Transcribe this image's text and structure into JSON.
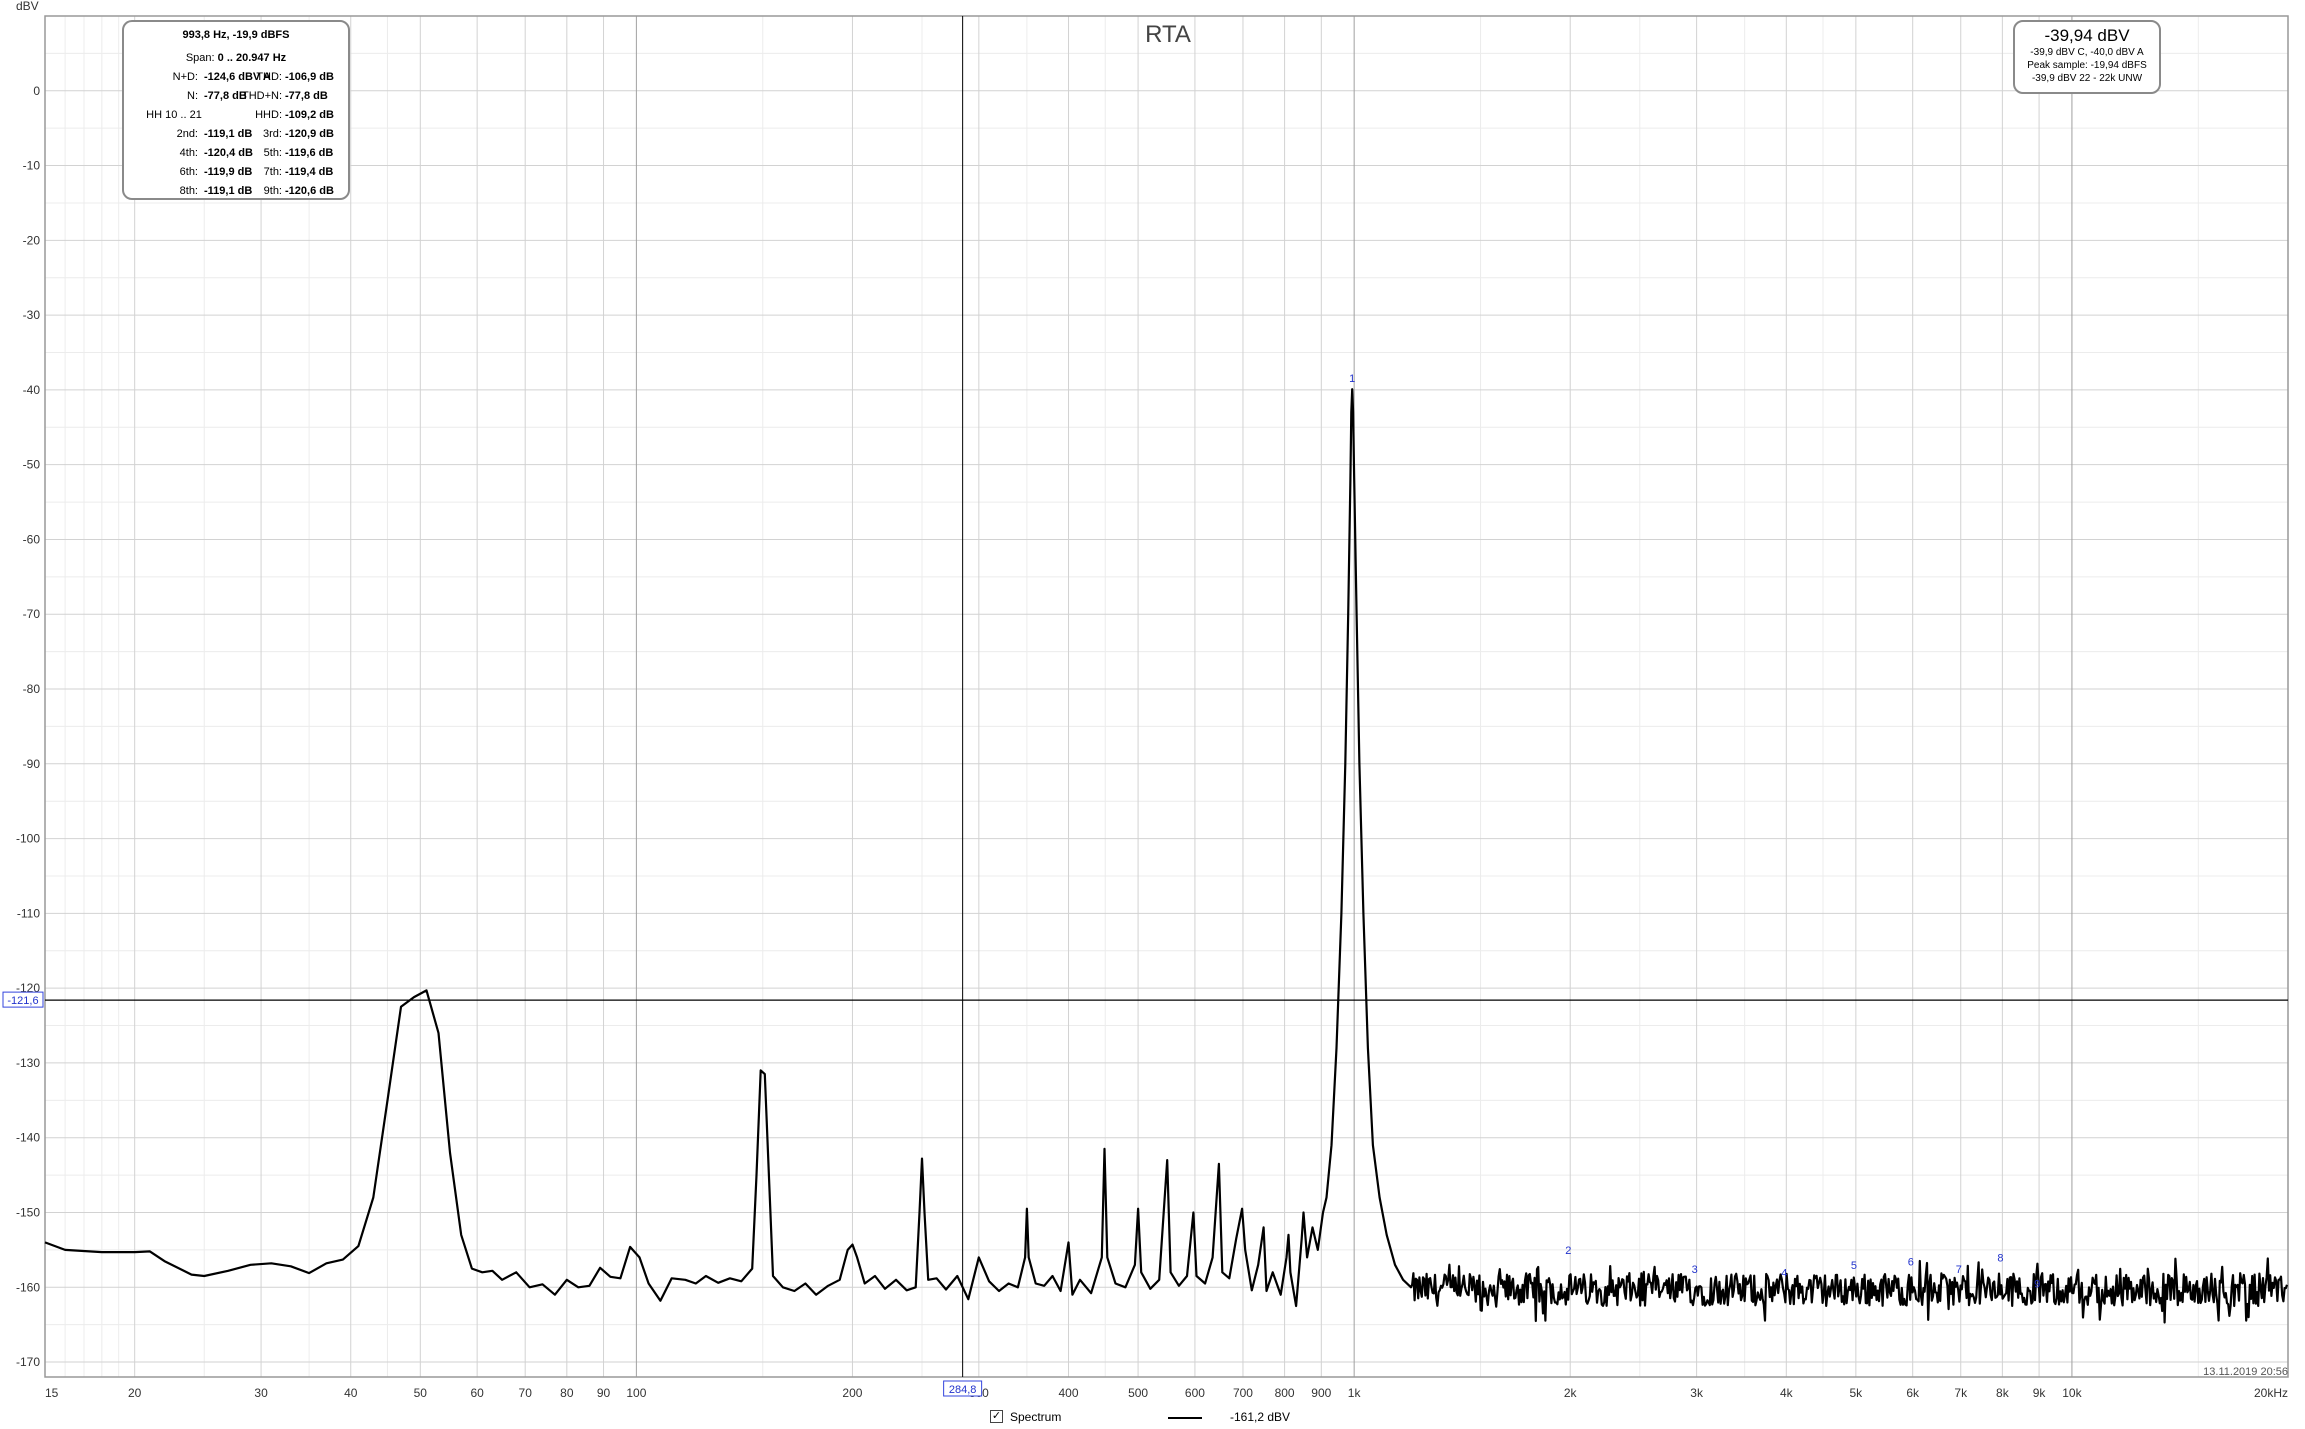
{
  "stats": {
    "freq_line": "993,8 Hz, -19,9 dBFS",
    "span_label": "Span:",
    "span_value": "0 .. 20.947 Hz",
    "rows": [
      {
        "l": "N+D:",
        "lv": "-124,6 dBV A",
        "r": "THD:",
        "rv": "-106,9 dB"
      },
      {
        "l": "N:",
        "lv": "-77,8 dB",
        "r": "THD+N:",
        "rv": "-77,8 dB"
      },
      {
        "c": "HH 10 .. 21",
        "r": "HHD:",
        "rv": "-109,2 dB"
      },
      {
        "l": "2nd:",
        "lv": "-119,1 dB",
        "r": "3rd:",
        "rv": "-120,9 dB"
      },
      {
        "l": "4th:",
        "lv": "-120,4 dB",
        "r": "5th:",
        "rv": "-119,6 dB"
      },
      {
        "l": "6th:",
        "lv": "-119,9 dB",
        "r": "7th:",
        "rv": "-119,4 dB"
      },
      {
        "l": "8th:",
        "lv": "-119,1 dB",
        "r": "9th:",
        "rv": "-120,6 dB"
      }
    ]
  },
  "level": {
    "main": "-39,94 dBV",
    "line1": "-39,9 dBV C, -40,0 dBV A",
    "line2": "Peak sample: -19,94 dBFS",
    "line3": "-39,9 dBV 22 - 22k UNW"
  },
  "legend": {
    "checked": true,
    "checkbox_mark": "✓",
    "label": "Spectrum",
    "value": "-161,2 dBV"
  },
  "timestamp": "13.11.2019 20:56",
  "colors": {
    "trace": "#000000",
    "grid": "#d2d2d2",
    "cursor": "#000000",
    "marker_text": "#2233cc"
  },
  "chart_data": {
    "type": "line",
    "title": "RTA",
    "ylabel": "dBV",
    "xscale": "log",
    "xlim": [
      15,
      20000
    ],
    "ylim": [
      -172,
      10
    ],
    "grid": true,
    "xticks": [
      {
        "v": 15,
        "t": "15"
      },
      {
        "v": 20,
        "t": "20"
      },
      {
        "v": 30,
        "t": "30"
      },
      {
        "v": 40,
        "t": "40"
      },
      {
        "v": 50,
        "t": "50"
      },
      {
        "v": 60,
        "t": "60"
      },
      {
        "v": 70,
        "t": "70"
      },
      {
        "v": 80,
        "t": "80"
      },
      {
        "v": 90,
        "t": "90"
      },
      {
        "v": 100,
        "t": "100"
      },
      {
        "v": 200,
        "t": "200"
      },
      {
        "v": 300,
        "t": "300"
      },
      {
        "v": 400,
        "t": "400"
      },
      {
        "v": 500,
        "t": "500"
      },
      {
        "v": 600,
        "t": "600"
      },
      {
        "v": 700,
        "t": "700"
      },
      {
        "v": 800,
        "t": "800"
      },
      {
        "v": 900,
        "t": "900"
      },
      {
        "v": 1000,
        "t": "1k"
      },
      {
        "v": 2000,
        "t": "2k"
      },
      {
        "v": 3000,
        "t": "3k"
      },
      {
        "v": 4000,
        "t": "4k"
      },
      {
        "v": 5000,
        "t": "5k"
      },
      {
        "v": 6000,
        "t": "6k"
      },
      {
        "v": 7000,
        "t": "7k"
      },
      {
        "v": 8000,
        "t": "8k"
      },
      {
        "v": 9000,
        "t": "9k"
      },
      {
        "v": 10000,
        "t": "10k"
      },
      {
        "v": 20000,
        "t": "20kHz"
      }
    ],
    "yticks": [
      0,
      -10,
      -20,
      -30,
      -40,
      -50,
      -60,
      -70,
      -80,
      -90,
      -100,
      -110,
      -120,
      -130,
      -140,
      -150,
      -160,
      -170
    ],
    "cursor": {
      "x": 284.8,
      "x_label": "284,8",
      "y": -121.6,
      "y_label": "-121,6"
    },
    "harmonic_markers": [
      {
        "n": "1",
        "f": 993.8,
        "db": -39.9
      },
      {
        "n": "2",
        "f": 1987.6,
        "db": -156.5
      },
      {
        "n": "3",
        "f": 2981.4,
        "db": -159.0
      },
      {
        "n": "4",
        "f": 3975.2,
        "db": -159.5
      },
      {
        "n": "5",
        "f": 4969.0,
        "db": -158.5
      },
      {
        "n": "6",
        "f": 5962.8,
        "db": -158.0
      },
      {
        "n": "7",
        "f": 6956.6,
        "db": -159.0
      },
      {
        "n": "8",
        "f": 7950.4,
        "db": -157.5
      },
      {
        "n": "9",
        "f": 8944.2,
        "db": -161.0
      }
    ],
    "series": [
      {
        "points": [
          [
            15,
            -154
          ],
          [
            16,
            -155
          ],
          [
            18,
            -155.3
          ],
          [
            20,
            -155.3
          ],
          [
            21,
            -155.2
          ],
          [
            22,
            -156.5
          ],
          [
            24,
            -158.3
          ],
          [
            25,
            -158.5
          ],
          [
            27,
            -157.8
          ],
          [
            29,
            -157.0
          ],
          [
            31,
            -156.8
          ],
          [
            33,
            -157.2
          ],
          [
            35,
            -158.1
          ],
          [
            37,
            -156.8
          ],
          [
            39,
            -156.3
          ],
          [
            41,
            -154.5
          ],
          [
            43,
            -148
          ],
          [
            45,
            -135
          ],
          [
            47,
            -122.5
          ],
          [
            49,
            -121.2
          ],
          [
            51,
            -120.3
          ],
          [
            53,
            -126
          ],
          [
            55,
            -142
          ],
          [
            57,
            -153
          ],
          [
            59,
            -157.5
          ],
          [
            61,
            -158
          ],
          [
            63,
            -157.8
          ],
          [
            65,
            -159
          ],
          [
            68,
            -158
          ],
          [
            71,
            -160
          ],
          [
            74,
            -159.6
          ],
          [
            77,
            -161
          ],
          [
            80,
            -159
          ],
          [
            83,
            -160
          ],
          [
            86,
            -159.8
          ],
          [
            89,
            -157.4
          ],
          [
            92,
            -158.6
          ],
          [
            95,
            -158.8
          ],
          [
            98,
            -154.6
          ],
          [
            101,
            -156
          ],
          [
            104,
            -159.5
          ],
          [
            108,
            -161.8
          ],
          [
            112,
            -158.8
          ],
          [
            117,
            -159
          ],
          [
            121,
            -159.5
          ],
          [
            125,
            -158.5
          ],
          [
            130,
            -159.4
          ],
          [
            135,
            -158.8
          ],
          [
            140,
            -159.2
          ],
          [
            145,
            -157.5
          ],
          [
            147,
            -145
          ],
          [
            149,
            -131
          ],
          [
            151,
            -131.5
          ],
          [
            153,
            -145
          ],
          [
            155,
            -158.5
          ],
          [
            160,
            -160
          ],
          [
            166,
            -160.5
          ],
          [
            172,
            -159.5
          ],
          [
            178,
            -161
          ],
          [
            185,
            -159.8
          ],
          [
            192,
            -159
          ],
          [
            197,
            -155
          ],
          [
            200,
            -154.3
          ],
          [
            203,
            -156
          ],
          [
            208,
            -159.5
          ],
          [
            215,
            -158.5
          ],
          [
            222,
            -160.2
          ],
          [
            230,
            -159
          ],
          [
            238,
            -160.4
          ],
          [
            245,
            -160
          ],
          [
            248,
            -150
          ],
          [
            250,
            -142.8
          ],
          [
            252,
            -150
          ],
          [
            255,
            -159
          ],
          [
            262,
            -158.8
          ],
          [
            270,
            -160.3
          ],
          [
            280,
            -158.5
          ],
          [
            290,
            -161.6
          ],
          [
            300,
            -156
          ],
          [
            310,
            -159.2
          ],
          [
            320,
            -160.5
          ],
          [
            330,
            -159.5
          ],
          [
            340,
            -160
          ],
          [
            348,
            -156
          ],
          [
            350,
            -149.5
          ],
          [
            352,
            -156
          ],
          [
            360,
            -159.5
          ],
          [
            370,
            -159.8
          ],
          [
            380,
            -158.5
          ],
          [
            390,
            -160.5
          ],
          [
            400,
            -154
          ],
          [
            405,
            -161
          ],
          [
            415,
            -159
          ],
          [
            430,
            -160.8
          ],
          [
            445,
            -156
          ],
          [
            449,
            -141.5
          ],
          [
            453,
            -156
          ],
          [
            465,
            -159.5
          ],
          [
            480,
            -160
          ],
          [
            495,
            -157
          ],
          [
            500,
            -149.5
          ],
          [
            505,
            -158
          ],
          [
            520,
            -160.2
          ],
          [
            535,
            -159
          ],
          [
            549,
            -143
          ],
          [
            555,
            -158
          ],
          [
            570,
            -159.8
          ],
          [
            585,
            -158.5
          ],
          [
            597,
            -150
          ],
          [
            603,
            -158.5
          ],
          [
            620,
            -159.5
          ],
          [
            635,
            -156
          ],
          [
            648,
            -143.5
          ],
          [
            655,
            -158
          ],
          [
            670,
            -158.8
          ],
          [
            685,
            -153.5
          ],
          [
            698,
            -149.5
          ],
          [
            705,
            -155
          ],
          [
            720,
            -160.4
          ],
          [
            735,
            -157
          ],
          [
            748,
            -152
          ],
          [
            755,
            -160.5
          ],
          [
            770,
            -158
          ],
          [
            790,
            -161
          ],
          [
            805,
            -156
          ],
          [
            810,
            -153
          ],
          [
            815,
            -158
          ],
          [
            830,
            -162.5
          ],
          [
            845,
            -153.5
          ],
          [
            850,
            -150
          ],
          [
            860,
            -156
          ],
          [
            875,
            -152
          ],
          [
            890,
            -155
          ],
          [
            905,
            -150
          ],
          [
            915,
            -148
          ],
          [
            930,
            -141
          ],
          [
            945,
            -128
          ],
          [
            960,
            -110
          ],
          [
            972,
            -90
          ],
          [
            981,
            -70
          ],
          [
            988,
            -52
          ],
          [
            991,
            -43
          ],
          [
            993.8,
            -39.9
          ],
          [
            996.5,
            -43
          ],
          [
            1000,
            -52
          ],
          [
            1008,
            -70
          ],
          [
            1017,
            -90
          ],
          [
            1030,
            -110
          ],
          [
            1045,
            -128
          ],
          [
            1062,
            -141
          ],
          [
            1085,
            -148
          ],
          [
            1110,
            -153
          ],
          [
            1140,
            -157
          ],
          [
            1170,
            -159
          ],
          [
            1200,
            -160
          ]
        ],
        "noise_floor": {
          "from": 1200,
          "to": 20000,
          "mean": -160.3,
          "spread": 2.2,
          "spike_max": -156
        }
      }
    ]
  }
}
